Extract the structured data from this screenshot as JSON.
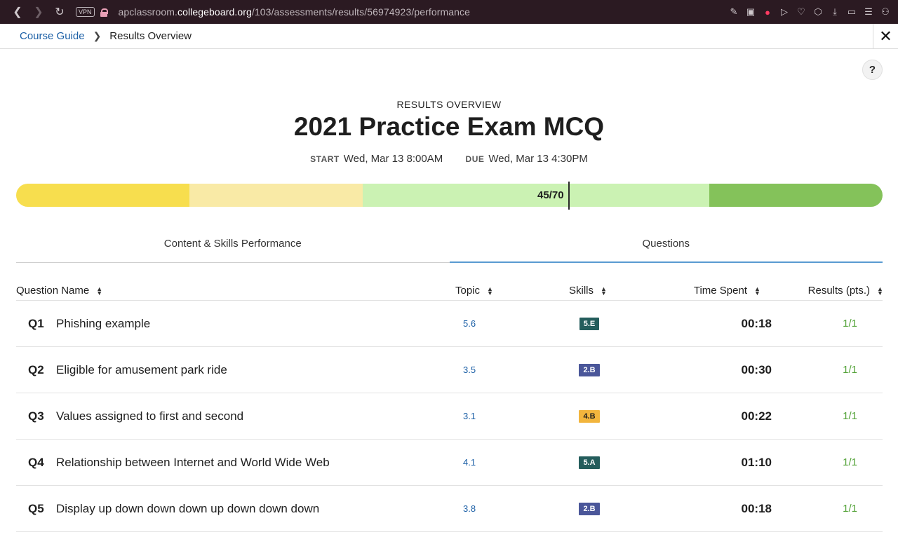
{
  "browser": {
    "vpn": "VPN",
    "url_prefix": "apclassroom.",
    "url_domain": "collegeboard.org",
    "url_path": "/103/assessments/results/56974923/performance"
  },
  "breadcrumb": {
    "link": "Course Guide",
    "current": "Results Overview"
  },
  "help_label": "?",
  "overview_label": "RESULTS OVERVIEW",
  "exam_title": "2021 Practice Exam MCQ",
  "dates": {
    "start_label": "START",
    "start_value": "Wed, Mar 13 8:00AM",
    "due_label": "DUE",
    "due_value": "Wed, Mar 13 4:30PM"
  },
  "score": {
    "text": "45/70",
    "earned": 45,
    "total": 70,
    "segment_colors": [
      "#f7de4e",
      "#f9eaa6",
      "#cbf2b3",
      "#cbf2b3",
      "#84c25a"
    ]
  },
  "tabs": [
    {
      "label": "Content & Skills Performance",
      "active": false
    },
    {
      "label": "Questions",
      "active": true
    }
  ],
  "table": {
    "headers": {
      "name": "Question Name",
      "topic": "Topic",
      "skills": "Skills",
      "time": "Time Spent",
      "results": "Results (pts.)"
    },
    "rows": [
      {
        "num": "Q1",
        "name": "Phishing example",
        "topic": "5.6",
        "skill": "5.E",
        "skill_color": "#245d5c",
        "skill_text_color": "#ffffff",
        "time": "00:18",
        "result": "1/1"
      },
      {
        "num": "Q2",
        "name": "Eligible for amusement park ride",
        "topic": "3.5",
        "skill": "2.B",
        "skill_color": "#4a5699",
        "skill_text_color": "#ffffff",
        "time": "00:30",
        "result": "1/1"
      },
      {
        "num": "Q3",
        "name": "Values assigned to first and second",
        "topic": "3.1",
        "skill": "4.B",
        "skill_color": "#f2b53d",
        "skill_text_color": "#1e1e1e",
        "time": "00:22",
        "result": "1/1"
      },
      {
        "num": "Q4",
        "name": "Relationship between Internet and World Wide Web",
        "topic": "4.1",
        "skill": "5.A",
        "skill_color": "#245d5c",
        "skill_text_color": "#ffffff",
        "time": "01:10",
        "result": "1/1"
      },
      {
        "num": "Q5",
        "name": "Display up down down down up down down down",
        "topic": "3.8",
        "skill": "2.B",
        "skill_color": "#4a5699",
        "skill_text_color": "#ffffff",
        "time": "00:18",
        "result": "1/1"
      }
    ]
  }
}
